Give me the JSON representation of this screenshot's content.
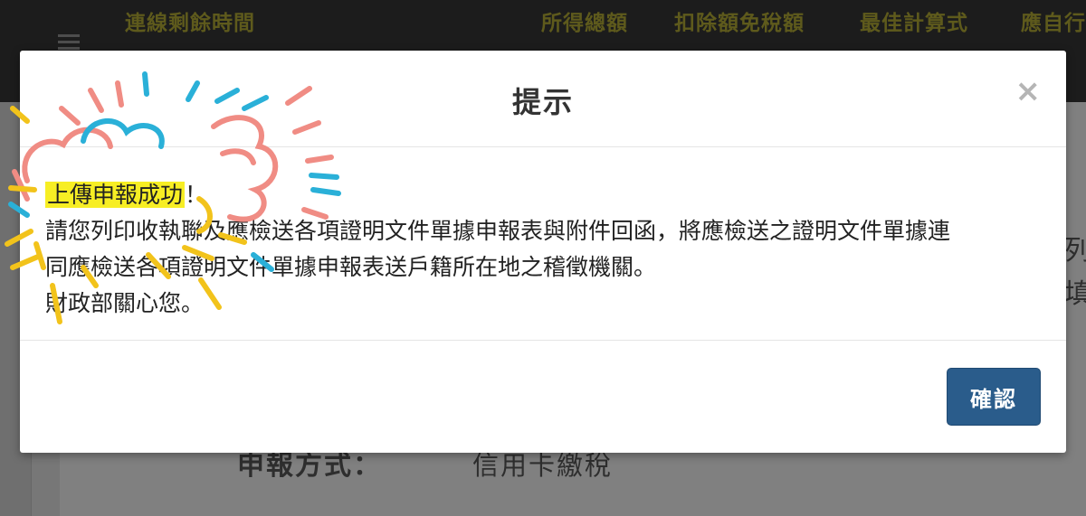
{
  "background": {
    "header_columns": [
      "連線剩餘時間",
      "所得總額",
      "扣除額免稅額",
      "最佳計算式",
      "應自行"
    ],
    "right_edge_text": [
      "列",
      "填"
    ],
    "method_label": "申報方式：",
    "method_value": "信用卡繳稅"
  },
  "modal": {
    "title": "提示",
    "close_symbol": "×",
    "body": {
      "highlight": "上傳申報成功",
      "highlight_suffix": "！",
      "line2": "請您列印收執聯及應檢送各項證明文件單據申報表與附件回函，將應檢送之證明文件單據連",
      "line3": "同應檢送各項證明文件單據申報表送戶籍所在地之稽徵機關。",
      "line4": "財政部關心您。"
    },
    "confirm_label": "確認"
  },
  "colors": {
    "accent": "#2a5c8b",
    "highlight": "#f7ee24",
    "header_text": "#5e5a1c",
    "doodle_red": "#f08c84",
    "doodle_blue": "#2ab0d8",
    "doodle_yellow": "#f2c31b"
  }
}
